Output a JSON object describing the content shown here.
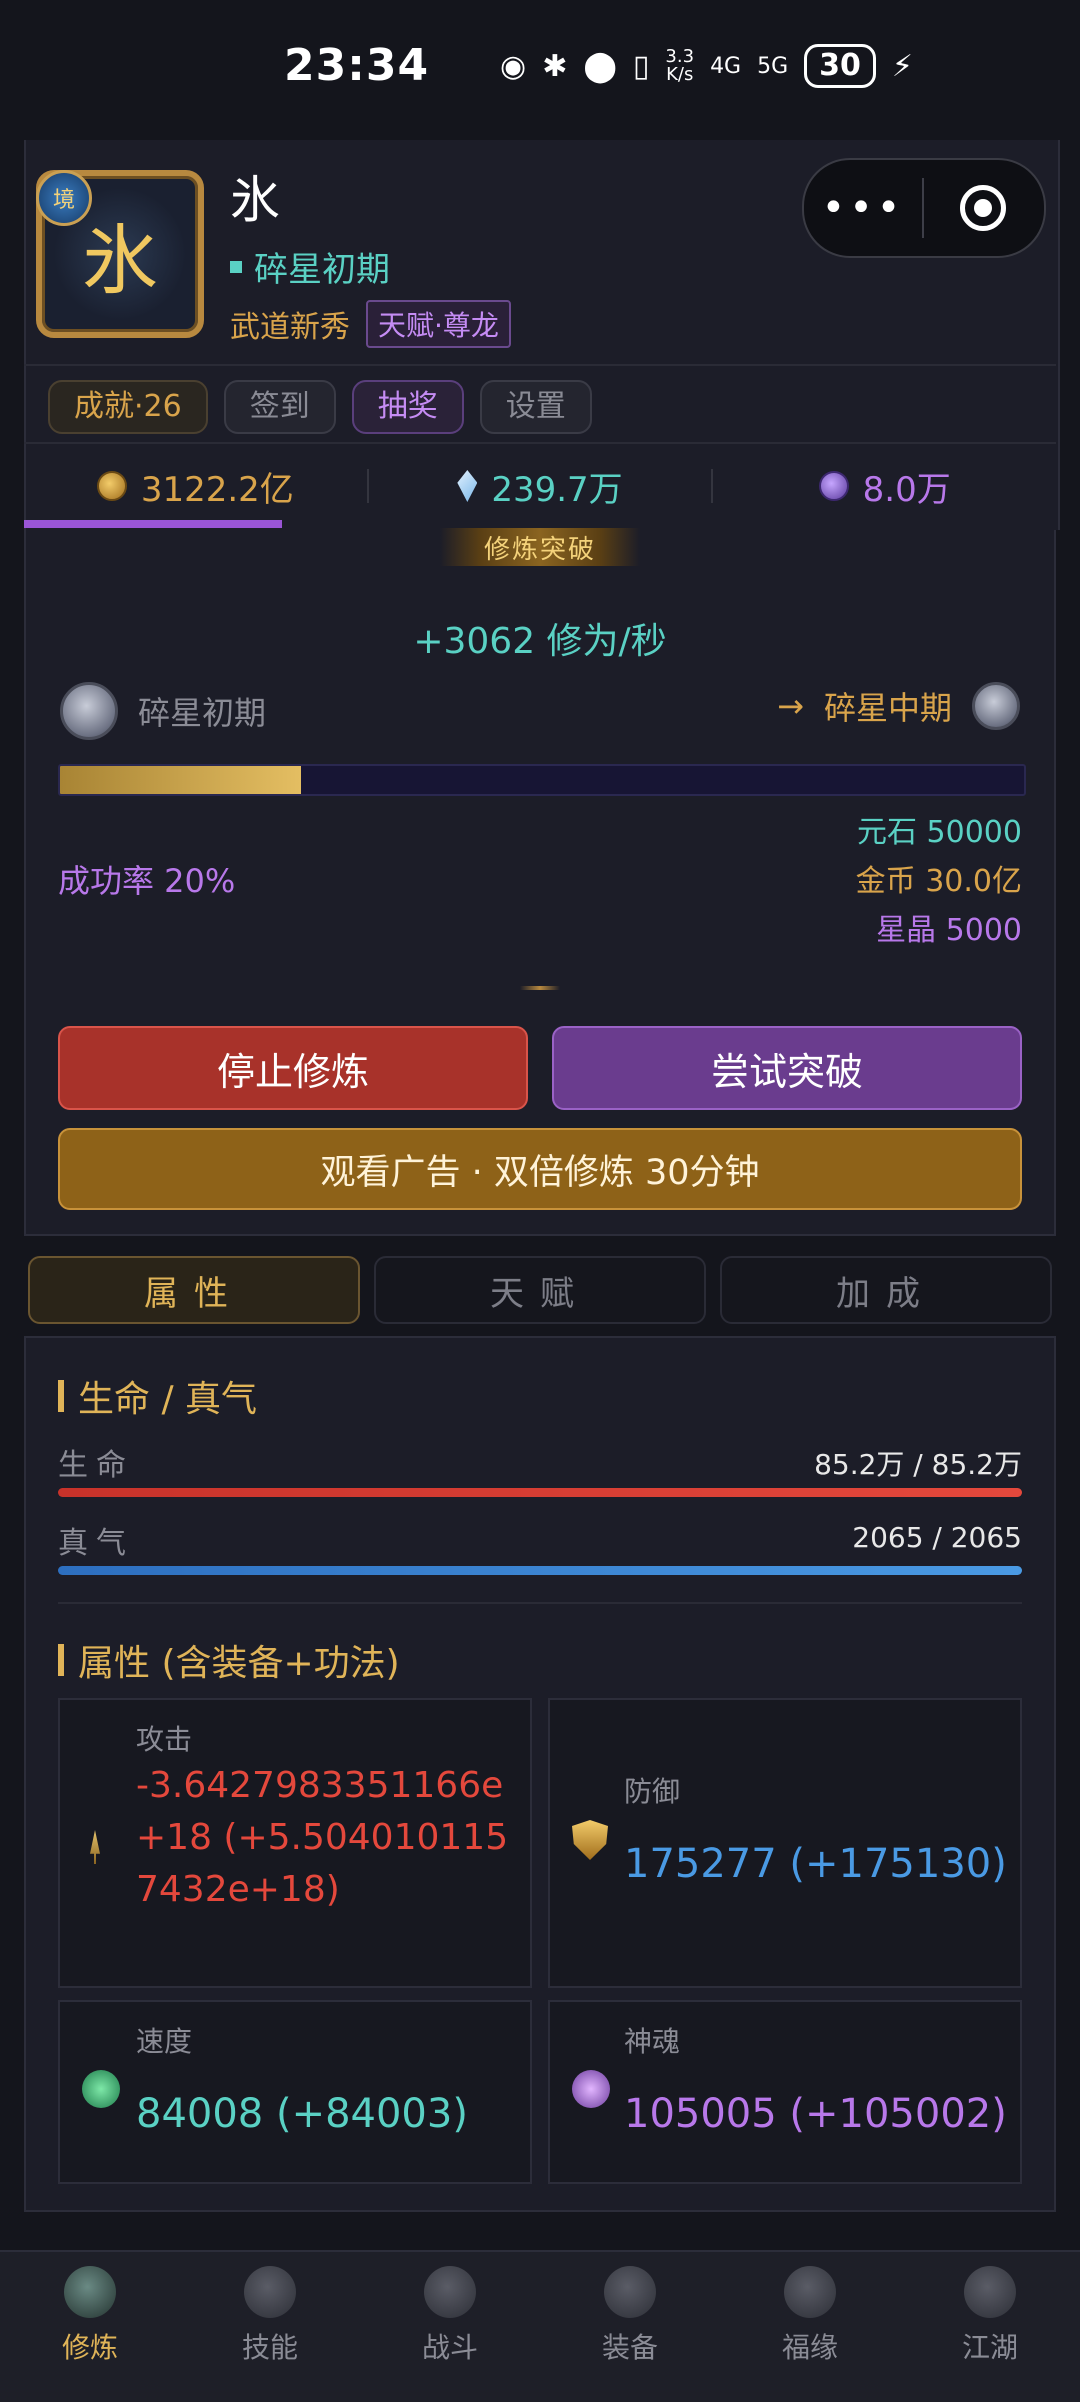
{
  "status_bar": {
    "time": "23:34",
    "net_speed_top": "3.3",
    "net_speed_bottom": "K/s",
    "net1": "4G",
    "net2": "5G",
    "battery": "30"
  },
  "profile": {
    "avatar_char": "氷",
    "avatar_badge": "境",
    "name": "氷",
    "realm": "碎星初期",
    "rank_title": "武道新秀",
    "talent_tag": "天赋·尊龙"
  },
  "chips": {
    "achievement": "成就·26",
    "checkin": "签到",
    "draw": "抽奖",
    "settings": "设置"
  },
  "resources": {
    "gold": "3122.2亿",
    "yuanshi": "239.7万",
    "xingjing": "8.0万"
  },
  "cultivation": {
    "ribbon": "修炼突破",
    "rate": "+3062 修为/秒",
    "stage_from": "碎星初期",
    "stage_to_arrow": "→",
    "stage_to": "碎星中期",
    "progress": 0.25,
    "success_rate": "成功率 20%",
    "cost_yuanshi": "元石 50000",
    "cost_gold": "金币 30.0亿",
    "cost_xingjing": "星晶 5000",
    "stop_label": "停止修炼",
    "breakthrough_label": "尝试突破",
    "ad_label": "观看广告 · 双倍修炼 30分钟"
  },
  "tabs": [
    "属性",
    "天赋",
    "加成"
  ],
  "stats": {
    "life_title": "生命 / 真气",
    "hp_label": "生命",
    "hp_value": "85.2万 / 85.2万",
    "hp_fraction": 1.0,
    "qi_label": "真气",
    "qi_value": "2065 / 2065",
    "qi_fraction": 1.0,
    "attr_title": "属性 (含装备+功法)",
    "attack_label": "攻击",
    "attack_value": "-3.6427983351166e+18 (+5.5040101157432e+18)",
    "defense_label": "防御",
    "defense_value": "175277 (+175130)",
    "speed_label": "速度",
    "speed_value": "84008 (+84003)",
    "soul_label": "神魂",
    "soul_value": "105005 (+105002)"
  },
  "colors": {
    "accent_gold": "#e0b458",
    "teal": "#5ad1c4",
    "purple": "#b878ea",
    "red": "#e4483c",
    "blue": "#4a9ae4"
  },
  "nav": [
    {
      "label": "修炼",
      "icon": "cultivate-icon",
      "active": true
    },
    {
      "label": "技能",
      "icon": "skill-icon",
      "active": false
    },
    {
      "label": "战斗",
      "icon": "battle-icon",
      "active": false
    },
    {
      "label": "装备",
      "icon": "equip-icon",
      "active": false
    },
    {
      "label": "福缘",
      "icon": "fortune-icon",
      "active": false
    },
    {
      "label": "江湖",
      "icon": "jianghu-icon",
      "active": false
    }
  ]
}
